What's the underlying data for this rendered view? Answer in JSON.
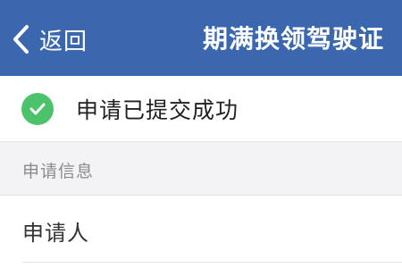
{
  "navbar": {
    "back_label": "返回",
    "title": "期满换领驾驶证",
    "back_icon": "chevron-left-icon",
    "background_color": "#3a67ad"
  },
  "status": {
    "text": "申请已提交成功",
    "icon": "check-circle-icon",
    "icon_color": "#4cc36b"
  },
  "section": {
    "title": "申请信息"
  },
  "fields": [
    {
      "label": "申请人"
    }
  ]
}
